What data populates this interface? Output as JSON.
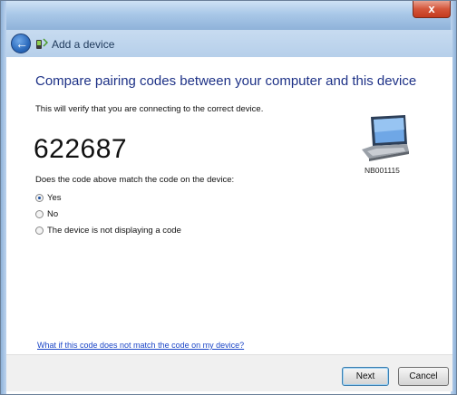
{
  "window": {
    "close_glyph": "x"
  },
  "nav": {
    "title": "Add a device"
  },
  "content": {
    "heading": "Compare pairing codes between your computer and this device",
    "subtext": "This will verify that you are connecting to the correct device.",
    "code": "622687",
    "question": "Does the code above match the code on the device:",
    "options": [
      {
        "label": "Yes",
        "checked": true
      },
      {
        "label": "No",
        "checked": false
      },
      {
        "label": "The device is not displaying a code",
        "checked": false
      }
    ],
    "device_name": "NB001115",
    "help_link": "What if this code does not match the code on my device?"
  },
  "footer": {
    "next_label": "Next",
    "cancel_label": "Cancel"
  },
  "colors": {
    "heading": "#1e3287",
    "link": "#1b46c7",
    "close": "#c43a1e"
  }
}
